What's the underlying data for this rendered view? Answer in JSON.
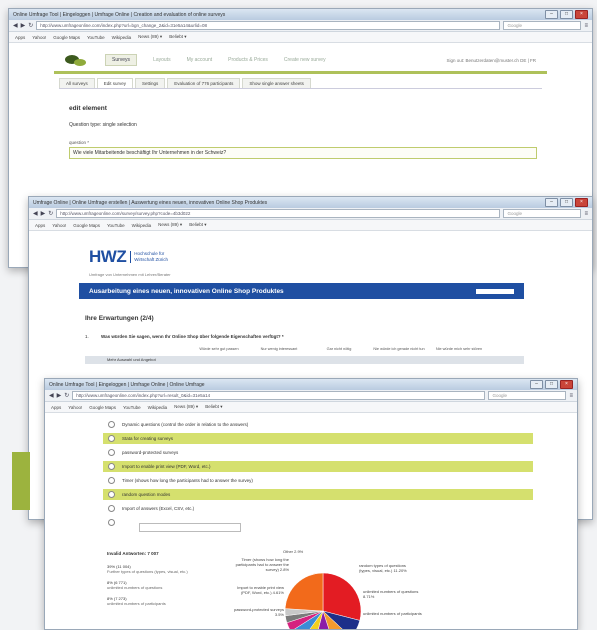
{
  "window1": {
    "title": "Online Umfrage Tool | Eingeloggen | Umfrage Online | Creation and evaluation of online surveys",
    "url": "http://www.umfrageonline.com/index.php?url=bgn_change_2&id=31e5a14&urlid=08",
    "bookmarks": [
      "Apps",
      "Yahoo!",
      "Google Maps",
      "YouTube",
      "Wikipedia",
      "News (89) ▾",
      "Beliebt ▾"
    ],
    "tabs": [
      "Surveys",
      "Layouts",
      "My account",
      "Products & Prices",
      "Create new survey"
    ],
    "active_tab": "Surveys",
    "user_info": "Sign out: Benutzerdaten@muster.ch  DE | FR",
    "subtabs": [
      "All surveys",
      "Edit survey",
      "Settings",
      "Evaluation of 776 participants",
      "Show single answer sheets"
    ],
    "active_subtab": "Edit survey",
    "heading": "edit element",
    "question_type": "Question type: single selection",
    "question_label": "question *",
    "question_value": "Wie viele Mitarbeitende beschäftigt Ihr Unternehmen in der Schweiz?"
  },
  "window2": {
    "title": "Umfrage Online | Online Umfrage erstellen | Auswertung eines neuen, innovativen Online Shop Produktes",
    "url": "http://www.umfrageonline.com/survey/survey.php?code=4b3d022",
    "bookmarks": [
      "Apps",
      "Yahoo!",
      "Google Maps",
      "YouTube",
      "Wikipedia",
      "News (89) ▾",
      "Beliebt ▾"
    ],
    "logo": "HWZ",
    "logo_sub1": "Hochschule für",
    "logo_sub2": "Wirtschaft Zürich",
    "logo_tagline": "Umfrage von Unternehmen mit Lehrer/Berater",
    "banner": "Ausarbeitung eines neuen, innovativen Online Shop Produktes",
    "section_title": "Ihre Erwartungen (2/4)",
    "question_number": "1.",
    "question_text": "Was würden Sie sagen, wenn Ihr Online Shop über folgende Eigenschaften verfügt? *",
    "col_headers": [
      "Würde sehr gut passen",
      "Nur wenig interessant",
      "Gar nicht nötig",
      "Nie würde ich gerade nicht tun",
      "Nie würde mich sehr stören"
    ],
    "row1": "Mehr Auswahl und Angebot"
  },
  "window3": {
    "title": "Online Umfrage Tool | Eingeloggen | Umfrage Online | Online Umfrage",
    "url": "http://www.umfrageonline.com/index.php?url=result_0&id=31e5a14",
    "bookmarks": [
      "Apps",
      "Yahoo!",
      "Google Maps",
      "YouTube",
      "Wikipedia",
      "News (89) ▾",
      "Beliebt ▾"
    ],
    "options": [
      {
        "label": "Dynamic questions (control the order in relation to the answers)",
        "highlight": false
      },
      {
        "label": "Stata for creating surveys",
        "highlight": true
      },
      {
        "label": "password-protected surveys",
        "highlight": false
      },
      {
        "label": "Import to enable print view (PDF, Word, etc.)",
        "highlight": true
      },
      {
        "label": "Timer (shows how long the participants had to answer the survey)",
        "highlight": false
      },
      {
        "label": "random question modes",
        "highlight": true
      },
      {
        "label": "Import of answers (Excel, CSV, etc.)",
        "highlight": false
      }
    ],
    "stats_title": "Invalid Antworten: 7 007",
    "stats": [
      {
        "value": "39% (11 004)",
        "label": "Further types of questions (types, visual, etc.)"
      },
      {
        "value": "8% (6 771)",
        "label": "unlimited numbers of questions"
      },
      {
        "value": "8% (7 273)",
        "label": "unlimited numbers of participants"
      }
    ],
    "pie_labels_left": [
      "Timer (shows how long the participants had to answer the survey) 2.8%",
      "Import to enable print view (PDF, Word, etc.) 4.61%",
      "password-protected surveys 3.5%"
    ],
    "pie_labels_right": [
      "random types of questions (types, visual, etc.) 11.20%",
      "unlimited numbers of questions 8.71%",
      "unlimited numbers of participants"
    ],
    "pie_top_label": "Other 2.9%"
  },
  "chart_data": {
    "type": "pie",
    "values": [
      29,
      8,
      8,
      9,
      6,
      6,
      4,
      3,
      3,
      24
    ],
    "colors": [
      "#e31c23",
      "#1c2f8a",
      "#f29a2e",
      "#8b1da8",
      "#f2cf1e",
      "#3b8cd6",
      "#d6227f",
      "#7a7a7a",
      "#c8c8c8",
      "#f26a1b"
    ]
  }
}
